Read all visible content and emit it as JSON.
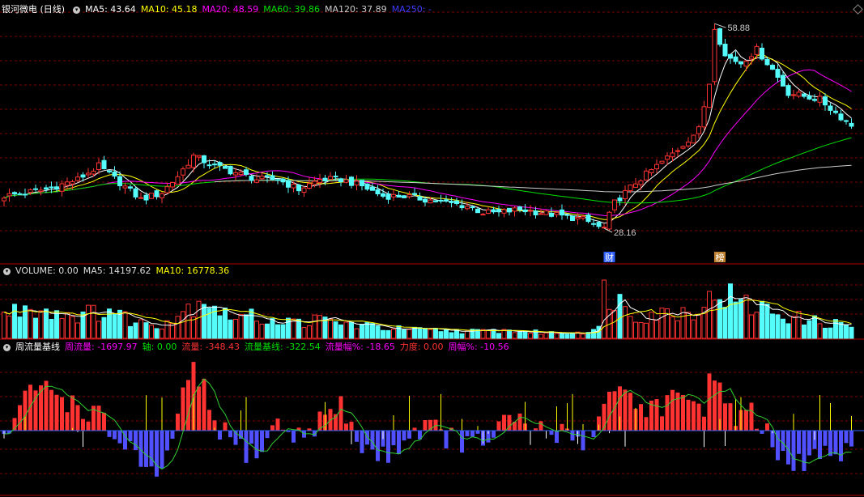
{
  "colors": {
    "up": "#ff3232",
    "down": "#54fcfc",
    "ma5": "#ffffff",
    "ma10": "#ffff00",
    "ma20": "#ff00ff",
    "ma60": "#00e000",
    "ma120": "#cccccc",
    "ma250": "#3c3cff",
    "grid": "#800000",
    "neg_bar": "#5050ff"
  },
  "price_panel": {
    "title": "银河微电 (日线)",
    "legend": [
      {
        "label": "MA5: 43.64",
        "color": "#ffffff"
      },
      {
        "label": "MA10: 45.18",
        "color": "#ffff00"
      },
      {
        "label": "MA20: 48.59",
        "color": "#ff00ff"
      },
      {
        "label": "MA60: 39.86",
        "color": "#00e000"
      },
      {
        "label": "MA120: 37.89",
        "color": "#cccccc"
      },
      {
        "label": "MA250: -",
        "color": "#3c3cff"
      }
    ],
    "high_label": "58.88",
    "low_label": "28.16",
    "markers": [
      "财",
      "榜"
    ]
  },
  "volume_panel": {
    "legend": [
      {
        "label": "VOLUME: 0.00",
        "color": "#dddddd"
      },
      {
        "label": "MA5: 14197.62",
        "color": "#dddddd"
      },
      {
        "label": "MA10: 16778.36",
        "color": "#ffff00"
      }
    ]
  },
  "flow_panel": {
    "title": "周流量基线",
    "legend": [
      {
        "label": "周流量: -1697.97",
        "color": "#ff00ff"
      },
      {
        "label": "轴: 0.00",
        "color": "#00e000"
      },
      {
        "label": "流量: -348.43",
        "color": "#ff3232"
      },
      {
        "label": "流量基线: -322.54",
        "color": "#00e000"
      },
      {
        "label": "流量幅%: -18.65",
        "color": "#ff00ff"
      },
      {
        "label": "力度: 0.00",
        "color": "#ff3232"
      },
      {
        "label": "周幅%: -10.56",
        "color": "#ff00ff"
      }
    ]
  },
  "chart_data": {
    "type": "candlestick",
    "price_keypoints": [
      [
        0,
        33.0
      ],
      [
        8,
        34.0
      ],
      [
        14,
        35.5
      ],
      [
        18,
        37.5
      ],
      [
        22,
        35.0
      ],
      [
        26,
        32.5
      ],
      [
        30,
        33.5
      ],
      [
        33,
        36.0
      ],
      [
        36,
        39.0
      ],
      [
        40,
        37.5
      ],
      [
        44,
        36.5
      ],
      [
        48,
        35.5
      ],
      [
        52,
        35.5
      ],
      [
        56,
        34.0
      ],
      [
        60,
        35.5
      ],
      [
        64,
        35.5
      ],
      [
        68,
        34.5
      ],
      [
        72,
        33.0
      ],
      [
        76,
        33.0
      ],
      [
        80,
        32.5
      ],
      [
        84,
        32.0
      ],
      [
        88,
        31.5
      ],
      [
        91,
        30.5
      ],
      [
        94,
        30.5
      ],
      [
        98,
        31.0
      ],
      [
        102,
        30.5
      ],
      [
        106,
        30.0
      ],
      [
        110,
        29.5
      ],
      [
        113,
        28.3
      ],
      [
        114,
        28.2
      ],
      [
        116,
        32.0
      ],
      [
        120,
        35.0
      ],
      [
        124,
        37.5
      ],
      [
        128,
        40.0
      ],
      [
        132,
        43.0
      ],
      [
        134,
        50.0
      ],
      [
        135,
        58.5
      ],
      [
        137,
        54.0
      ],
      [
        140,
        53.0
      ],
      [
        143,
        55.0
      ],
      [
        146,
        52.0
      ],
      [
        149,
        48.5
      ],
      [
        152,
        48.0
      ],
      [
        155,
        47.5
      ],
      [
        158,
        45.5
      ],
      [
        161,
        43.6
      ]
    ],
    "high": 58.88,
    "low": 28.16,
    "volume_keypoints": [
      [
        0,
        0.45
      ],
      [
        5,
        0.62
      ],
      [
        10,
        0.5
      ],
      [
        15,
        0.45
      ],
      [
        20,
        0.55
      ],
      [
        25,
        0.3
      ],
      [
        30,
        0.28
      ],
      [
        35,
        0.58
      ],
      [
        38,
        0.82
      ],
      [
        42,
        0.45
      ],
      [
        48,
        0.4
      ],
      [
        55,
        0.3
      ],
      [
        60,
        0.35
      ],
      [
        65,
        0.28
      ],
      [
        70,
        0.22
      ],
      [
        75,
        0.18
      ],
      [
        80,
        0.15
      ],
      [
        85,
        0.15
      ],
      [
        90,
        0.13
      ],
      [
        95,
        0.15
      ],
      [
        100,
        0.12
      ],
      [
        105,
        0.1
      ],
      [
        110,
        0.13
      ],
      [
        113,
        0.18
      ],
      [
        114,
        0.95
      ],
      [
        117,
        0.7
      ],
      [
        120,
        0.45
      ],
      [
        125,
        0.48
      ],
      [
        130,
        0.52
      ],
      [
        134,
        0.7
      ],
      [
        136,
        0.92
      ],
      [
        140,
        0.65
      ],
      [
        145,
        0.55
      ],
      [
        150,
        0.4
      ],
      [
        155,
        0.3
      ],
      [
        161,
        0.25
      ]
    ],
    "flow_keypoints": [
      [
        0,
        -0.1
      ],
      [
        4,
        0.4
      ],
      [
        7,
        0.6
      ],
      [
        10,
        0.5
      ],
      [
        14,
        0.3
      ],
      [
        18,
        0.2
      ],
      [
        20,
        -0.05
      ],
      [
        24,
        -0.2
      ],
      [
        27,
        -0.55
      ],
      [
        29,
        -0.7
      ],
      [
        31,
        -0.4
      ],
      [
        33,
        0.3
      ],
      [
        36,
        0.75
      ],
      [
        38,
        0.5
      ],
      [
        40,
        0.1
      ],
      [
        44,
        -0.2
      ],
      [
        48,
        -0.3
      ],
      [
        52,
        0.1
      ],
      [
        56,
        -0.1
      ],
      [
        60,
        0.15
      ],
      [
        64,
        0.3
      ],
      [
        68,
        -0.2
      ],
      [
        72,
        -0.35
      ],
      [
        76,
        -0.1
      ],
      [
        80,
        0.08
      ],
      [
        85,
        -0.1
      ],
      [
        90,
        -0.2
      ],
      [
        95,
        0.1
      ],
      [
        100,
        0.05
      ],
      [
        105,
        -0.05
      ],
      [
        110,
        -0.1
      ],
      [
        113,
        0.1
      ],
      [
        115,
        0.6
      ],
      [
        118,
        0.5
      ],
      [
        121,
        0.3
      ],
      [
        125,
        0.35
      ],
      [
        127,
        0.45
      ],
      [
        130,
        0.25
      ],
      [
        133,
        0.35
      ],
      [
        134,
        0.9
      ],
      [
        136,
        0.5
      ],
      [
        138,
        0.2
      ],
      [
        141,
        0.3
      ],
      [
        144,
        0.1
      ],
      [
        147,
        -0.4
      ],
      [
        150,
        -0.5
      ],
      [
        154,
        -0.3
      ],
      [
        158,
        -0.35
      ],
      [
        161,
        -0.3
      ]
    ]
  }
}
